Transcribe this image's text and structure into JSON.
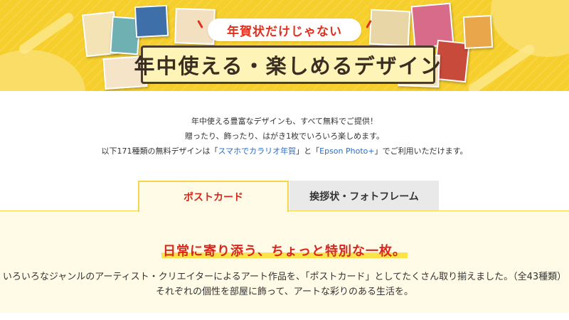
{
  "hero": {
    "ribbon_text": "年賀状だけじゃない",
    "title": "年中使える・楽しめるデザイン"
  },
  "intro": {
    "line1": "年中使える豊富なデザインも、すべて無料でご提供！",
    "line2": "贈ったり、飾ったり、はがき1枚でいろいろ楽しめます。",
    "line3_prefix": "以下171種類の無料デザインは「",
    "link_app1": "スマホでカラリオ年賀",
    "line3_mid": "」と「",
    "link_app2": "Epson Photo+",
    "line3_suffix": "」でご利用いただけます。"
  },
  "tabs": [
    {
      "label": "ポストカード",
      "active": true
    },
    {
      "label": "挨拶状・フォトフレーム",
      "active": false
    }
  ],
  "panel": {
    "headline": "日常に寄り添う、ちょっと特別な一枚。",
    "desc_line1": "いろいろなジャンルのアーティスト・クリエイターによるアート作品を、「ポストカード」としてたくさん取り揃えました。（全43種類）",
    "desc_line2": "それぞれの個性を部屋に飾って、アートな彩りのある生活を。"
  },
  "colors": {
    "banner_yellow": "#f6cf2c",
    "accent_red": "#d8271c",
    "link_blue": "#2b6cc4",
    "panel_bg": "#fffbe6"
  }
}
